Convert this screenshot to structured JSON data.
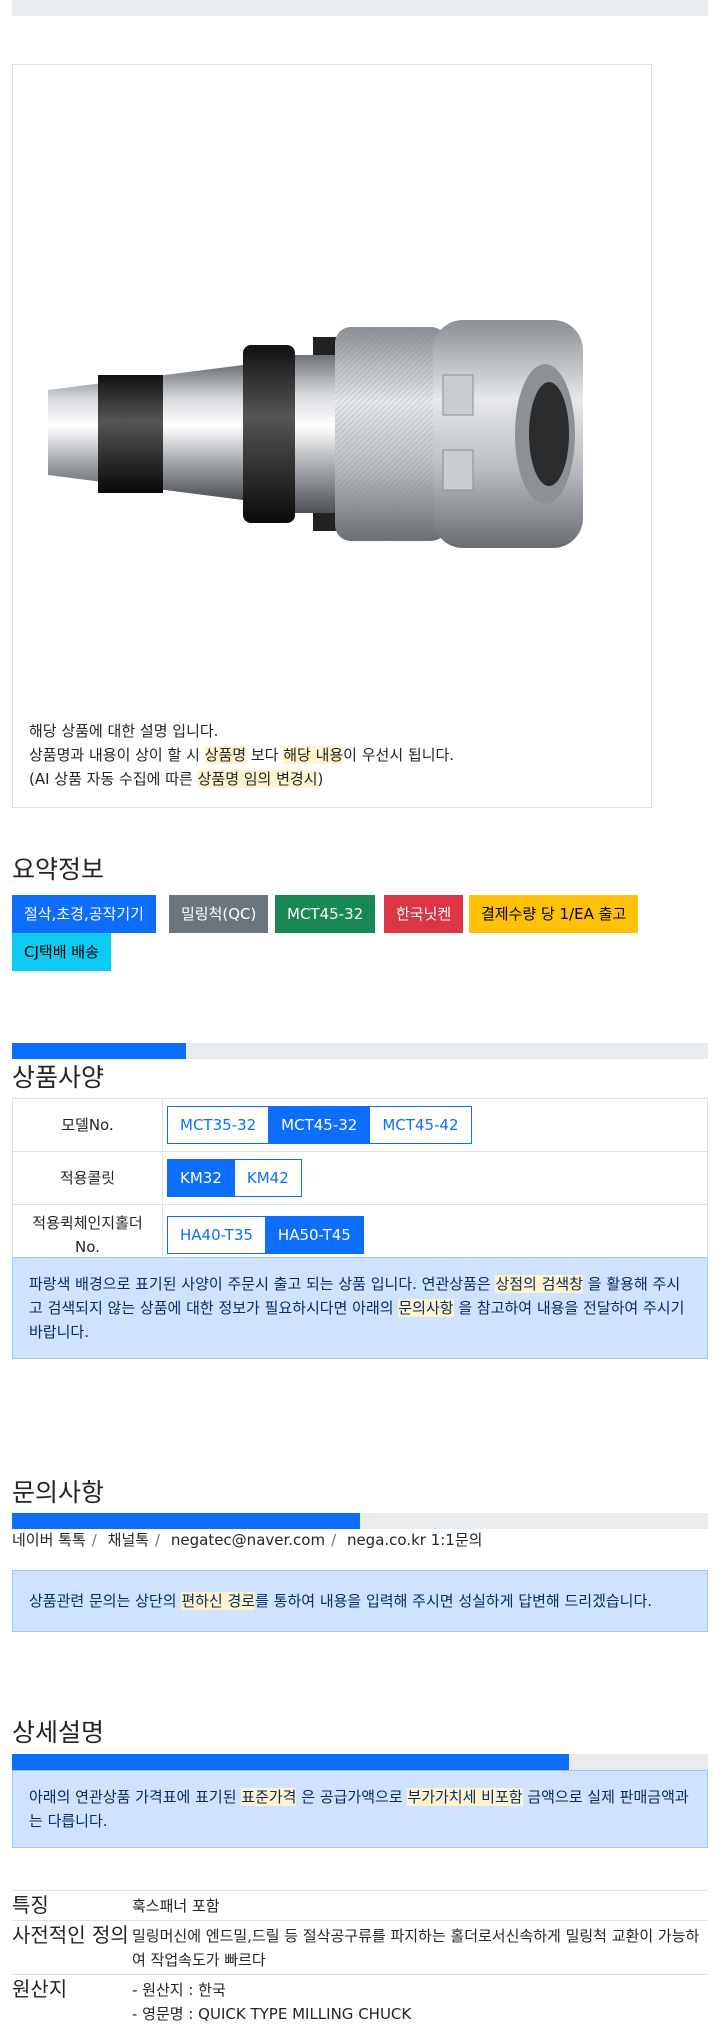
{
  "image_card": {
    "desc_line1": "해당 상품에 대한 설명 입니다.",
    "desc_line2_a": "상품명과 내용이 상이 할 시 ",
    "desc_line2_hl1": "상품명",
    "desc_line2_b": " 보다 ",
    "desc_line2_hl2": "해당 내용",
    "desc_line2_c": "이 우선시 됩니다.",
    "desc_line3_a": "(AI 상품 자동 수집에 따른 ",
    "desc_line3_hl": "상품명 임의 변경시",
    "desc_line3_b": ")"
  },
  "summary": {
    "title": "요약정보",
    "badges": [
      {
        "label": "절삭,초경,공작기기",
        "color": "#0d6efd",
        "text_color": "#ffffff"
      },
      {
        "label": "밀링척(QC)",
        "color": "#6c757d",
        "text_color": "#ffffff"
      },
      {
        "label": "MCT45-32",
        "color": "#198754",
        "text_color": "#ffffff"
      },
      {
        "label": "한국닛켄",
        "color": "#dc3545",
        "text_color": "#ffffff"
      },
      {
        "label": "결제수량 당 1/EA 출고",
        "color": "#ffc107",
        "text_color": "#000000"
      },
      {
        "label": "CJ택배 배송",
        "color": "#0dcaf0",
        "text_color": "#000000"
      }
    ]
  },
  "spec": {
    "progress_pct": 25,
    "title": "상품사양",
    "rows": [
      {
        "label": "모델No.",
        "options": [
          "MCT35-32",
          "MCT45-32",
          "MCT45-42"
        ],
        "active": 1
      },
      {
        "label": "적용콜릿",
        "options": [
          "KM32",
          "KM42"
        ],
        "active": 0
      },
      {
        "label": "적용퀵체인지홀더No.",
        "options": [
          "HA40-T35",
          "HA50-T45"
        ],
        "active": 1
      }
    ],
    "notice_a": "파랑색 배경으로 표기된 사양이 주문시 출고 되는 상품 입니다. 연관상품은 ",
    "notice_hl1": "상점의 검색창",
    "notice_b": " 을 활용해 주시고 검색되지 않는 상품에 대한 정보가 필요하시다면 아래의 ",
    "notice_hl2": "문의사항",
    "notice_c": " 을 참고하여 내용을 전달하여 주시기 바랍니다."
  },
  "inquiry": {
    "title": "문의사항",
    "progress_pct": 50,
    "channels": [
      "네이버 톡톡",
      "채널톡",
      "negatec@naver.com",
      "nega.co.kr 1:1문의"
    ],
    "notice_a": "상품관련 문의는 상단의 ",
    "notice_hl": "편하신 경로",
    "notice_b": "를 통하여 내용을 입력해 주시면 성실하게 답변해 드리겠습니다."
  },
  "detail": {
    "title": "상세설명",
    "progress_pct": 80,
    "notice_a": "아래의 연관상품 가격표에 표기된 ",
    "notice_hl1": "표준가격",
    "notice_b": " 은 공급가액으로 ",
    "notice_hl2": "부가가치세 비포함",
    "notice_c": " 금액으로 실제 판매금액과는 다릅니다.",
    "features": [
      {
        "key": "특징",
        "lines": [
          "훅스패너 포함"
        ]
      },
      {
        "key": "사전적인 정의",
        "lines": [
          "밀링머신에 엔드밀,드릴 등 절삭공구류를 파지하는 홀더로서신속하게 밀링척 교환이 가능하여 작업속도가 빠르다"
        ]
      },
      {
        "key": "원산지",
        "lines": [
          "- 원산지 : 한국",
          "- 영문명 : QUICK TYPE MILLING CHUCK"
        ]
      }
    ]
  }
}
